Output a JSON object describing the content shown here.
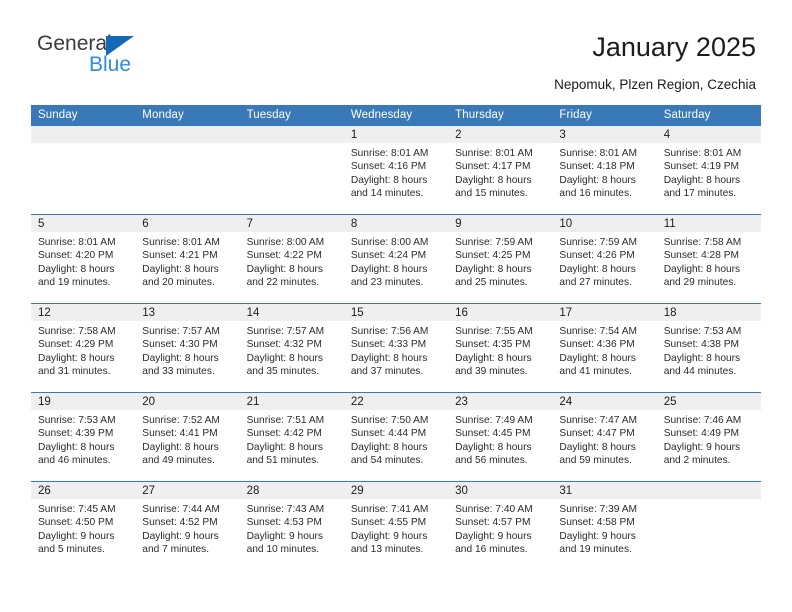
{
  "brand": {
    "name_top": "General",
    "name_bottom": "Blue",
    "accent_color": "#1369b5",
    "accent_color_light": "#2a8ce0",
    "triangle_icon": "triangle-icon"
  },
  "header": {
    "title": "January 2025",
    "subtitle": "Nepomuk, Plzen Region, Czechia"
  },
  "theme": {
    "header_blue": "#3a79b8",
    "day_band_gray": "#efefef",
    "text_color": "#222222"
  },
  "calendar": {
    "weekday_headers": [
      "Sunday",
      "Monday",
      "Tuesday",
      "Wednesday",
      "Thursday",
      "Friday",
      "Saturday"
    ],
    "weeks": [
      [
        {
          "day": "",
          "empty": true,
          "lines": []
        },
        {
          "day": "",
          "empty": true,
          "lines": []
        },
        {
          "day": "",
          "empty": true,
          "lines": []
        },
        {
          "day": "1",
          "empty": false,
          "lines": [
            "Sunrise: 8:01 AM",
            "Sunset: 4:16 PM",
            "Daylight: 8 hours",
            "and 14 minutes."
          ]
        },
        {
          "day": "2",
          "empty": false,
          "lines": [
            "Sunrise: 8:01 AM",
            "Sunset: 4:17 PM",
            "Daylight: 8 hours",
            "and 15 minutes."
          ]
        },
        {
          "day": "3",
          "empty": false,
          "lines": [
            "Sunrise: 8:01 AM",
            "Sunset: 4:18 PM",
            "Daylight: 8 hours",
            "and 16 minutes."
          ]
        },
        {
          "day": "4",
          "empty": false,
          "lines": [
            "Sunrise: 8:01 AM",
            "Sunset: 4:19 PM",
            "Daylight: 8 hours",
            "and 17 minutes."
          ]
        }
      ],
      [
        {
          "day": "5",
          "empty": false,
          "lines": [
            "Sunrise: 8:01 AM",
            "Sunset: 4:20 PM",
            "Daylight: 8 hours",
            "and 19 minutes."
          ]
        },
        {
          "day": "6",
          "empty": false,
          "lines": [
            "Sunrise: 8:01 AM",
            "Sunset: 4:21 PM",
            "Daylight: 8 hours",
            "and 20 minutes."
          ]
        },
        {
          "day": "7",
          "empty": false,
          "lines": [
            "Sunrise: 8:00 AM",
            "Sunset: 4:22 PM",
            "Daylight: 8 hours",
            "and 22 minutes."
          ]
        },
        {
          "day": "8",
          "empty": false,
          "lines": [
            "Sunrise: 8:00 AM",
            "Sunset: 4:24 PM",
            "Daylight: 8 hours",
            "and 23 minutes."
          ]
        },
        {
          "day": "9",
          "empty": false,
          "lines": [
            "Sunrise: 7:59 AM",
            "Sunset: 4:25 PM",
            "Daylight: 8 hours",
            "and 25 minutes."
          ]
        },
        {
          "day": "10",
          "empty": false,
          "lines": [
            "Sunrise: 7:59 AM",
            "Sunset: 4:26 PM",
            "Daylight: 8 hours",
            "and 27 minutes."
          ]
        },
        {
          "day": "11",
          "empty": false,
          "lines": [
            "Sunrise: 7:58 AM",
            "Sunset: 4:28 PM",
            "Daylight: 8 hours",
            "and 29 minutes."
          ]
        }
      ],
      [
        {
          "day": "12",
          "empty": false,
          "lines": [
            "Sunrise: 7:58 AM",
            "Sunset: 4:29 PM",
            "Daylight: 8 hours",
            "and 31 minutes."
          ]
        },
        {
          "day": "13",
          "empty": false,
          "lines": [
            "Sunrise: 7:57 AM",
            "Sunset: 4:30 PM",
            "Daylight: 8 hours",
            "and 33 minutes."
          ]
        },
        {
          "day": "14",
          "empty": false,
          "lines": [
            "Sunrise: 7:57 AM",
            "Sunset: 4:32 PM",
            "Daylight: 8 hours",
            "and 35 minutes."
          ]
        },
        {
          "day": "15",
          "empty": false,
          "lines": [
            "Sunrise: 7:56 AM",
            "Sunset: 4:33 PM",
            "Daylight: 8 hours",
            "and 37 minutes."
          ]
        },
        {
          "day": "16",
          "empty": false,
          "lines": [
            "Sunrise: 7:55 AM",
            "Sunset: 4:35 PM",
            "Daylight: 8 hours",
            "and 39 minutes."
          ]
        },
        {
          "day": "17",
          "empty": false,
          "lines": [
            "Sunrise: 7:54 AM",
            "Sunset: 4:36 PM",
            "Daylight: 8 hours",
            "and 41 minutes."
          ]
        },
        {
          "day": "18",
          "empty": false,
          "lines": [
            "Sunrise: 7:53 AM",
            "Sunset: 4:38 PM",
            "Daylight: 8 hours",
            "and 44 minutes."
          ]
        }
      ],
      [
        {
          "day": "19",
          "empty": false,
          "lines": [
            "Sunrise: 7:53 AM",
            "Sunset: 4:39 PM",
            "Daylight: 8 hours",
            "and 46 minutes."
          ]
        },
        {
          "day": "20",
          "empty": false,
          "lines": [
            "Sunrise: 7:52 AM",
            "Sunset: 4:41 PM",
            "Daylight: 8 hours",
            "and 49 minutes."
          ]
        },
        {
          "day": "21",
          "empty": false,
          "lines": [
            "Sunrise: 7:51 AM",
            "Sunset: 4:42 PM",
            "Daylight: 8 hours",
            "and 51 minutes."
          ]
        },
        {
          "day": "22",
          "empty": false,
          "lines": [
            "Sunrise: 7:50 AM",
            "Sunset: 4:44 PM",
            "Daylight: 8 hours",
            "and 54 minutes."
          ]
        },
        {
          "day": "23",
          "empty": false,
          "lines": [
            "Sunrise: 7:49 AM",
            "Sunset: 4:45 PM",
            "Daylight: 8 hours",
            "and 56 minutes."
          ]
        },
        {
          "day": "24",
          "empty": false,
          "lines": [
            "Sunrise: 7:47 AM",
            "Sunset: 4:47 PM",
            "Daylight: 8 hours",
            "and 59 minutes."
          ]
        },
        {
          "day": "25",
          "empty": false,
          "lines": [
            "Sunrise: 7:46 AM",
            "Sunset: 4:49 PM",
            "Daylight: 9 hours",
            "and 2 minutes."
          ]
        }
      ],
      [
        {
          "day": "26",
          "empty": false,
          "lines": [
            "Sunrise: 7:45 AM",
            "Sunset: 4:50 PM",
            "Daylight: 9 hours",
            "and 5 minutes."
          ]
        },
        {
          "day": "27",
          "empty": false,
          "lines": [
            "Sunrise: 7:44 AM",
            "Sunset: 4:52 PM",
            "Daylight: 9 hours",
            "and 7 minutes."
          ]
        },
        {
          "day": "28",
          "empty": false,
          "lines": [
            "Sunrise: 7:43 AM",
            "Sunset: 4:53 PM",
            "Daylight: 9 hours",
            "and 10 minutes."
          ]
        },
        {
          "day": "29",
          "empty": false,
          "lines": [
            "Sunrise: 7:41 AM",
            "Sunset: 4:55 PM",
            "Daylight: 9 hours",
            "and 13 minutes."
          ]
        },
        {
          "day": "30",
          "empty": false,
          "lines": [
            "Sunrise: 7:40 AM",
            "Sunset: 4:57 PM",
            "Daylight: 9 hours",
            "and 16 minutes."
          ]
        },
        {
          "day": "31",
          "empty": false,
          "lines": [
            "Sunrise: 7:39 AM",
            "Sunset: 4:58 PM",
            "Daylight: 9 hours",
            "and 19 minutes."
          ]
        },
        {
          "day": "",
          "empty": true,
          "lines": []
        }
      ]
    ]
  }
}
